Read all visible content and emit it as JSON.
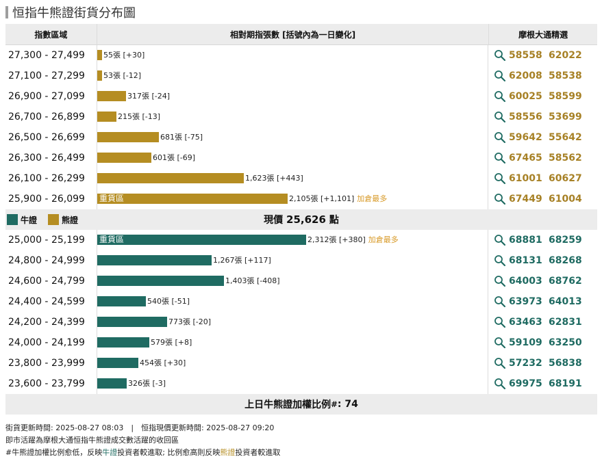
{
  "title": "恒指牛熊證街貨分布圖",
  "headers": {
    "range": "指數區域",
    "bars": "相對期指張數 [括號內為一日變化]",
    "picks": "摩根大通精選"
  },
  "colors": {
    "bear": "#b58d22",
    "bull": "#1f6b62",
    "most": "#d89a28"
  },
  "bear_rows": [
    {
      "range": "27,300 - 27,499",
      "count": 55,
      "label": "55張 [+30]",
      "inner": "",
      "most": "",
      "codes": [
        "58558",
        "62022"
      ]
    },
    {
      "range": "27,100 - 27,299",
      "count": 53,
      "label": "53張 [-12]",
      "inner": "",
      "most": "",
      "codes": [
        "62008",
        "58538"
      ]
    },
    {
      "range": "26,900 - 27,099",
      "count": 317,
      "label": "317張 [-24]",
      "inner": "",
      "most": "",
      "codes": [
        "60025",
        "58599"
      ]
    },
    {
      "range": "26,700 - 26,899",
      "count": 215,
      "label": "215張 [-13]",
      "inner": "",
      "most": "",
      "codes": [
        "58556",
        "53699"
      ]
    },
    {
      "range": "26,500 - 26,699",
      "count": 681,
      "label": "681張 [-75]",
      "inner": "",
      "most": "",
      "codes": [
        "59642",
        "55642"
      ]
    },
    {
      "range": "26,300 - 26,499",
      "count": 601,
      "label": "601張 [-69]",
      "inner": "",
      "most": "",
      "codes": [
        "67465",
        "58562"
      ]
    },
    {
      "range": "26,100 - 26,299",
      "count": 1623,
      "label": "1,623張 [+443]",
      "inner": "",
      "most": "",
      "codes": [
        "61001",
        "60627"
      ]
    },
    {
      "range": "25,900 - 26,099",
      "count": 2105,
      "label": "2,105張 [+1,101]",
      "inner": "重貨區",
      "most": "加倉最多",
      "codes": [
        "67449",
        "61004"
      ]
    }
  ],
  "legend": {
    "bull": "牛證",
    "bear": "熊證"
  },
  "current": {
    "prefix": "現價",
    "value": "25,626",
    "suffix": "點"
  },
  "bull_rows": [
    {
      "range": "25,000 - 25,199",
      "count": 2312,
      "label": "2,312張 [+380]",
      "inner": "重貨區",
      "most": "加倉最多",
      "codes": [
        "68881",
        "68259"
      ]
    },
    {
      "range": "24,800 - 24,999",
      "count": 1267,
      "label": "1,267張 [+117]",
      "inner": "",
      "most": "",
      "codes": [
        "68131",
        "68268"
      ]
    },
    {
      "range": "24,600 - 24,799",
      "count": 1403,
      "label": "1,403張 [-408]",
      "inner": "",
      "most": "",
      "codes": [
        "64003",
        "68762"
      ]
    },
    {
      "range": "24,400 - 24,599",
      "count": 540,
      "label": "540張 [-51]",
      "inner": "",
      "most": "",
      "codes": [
        "63973",
        "64013"
      ]
    },
    {
      "range": "24,200 - 24,399",
      "count": 773,
      "label": "773張 [-20]",
      "inner": "",
      "most": "",
      "codes": [
        "63463",
        "62831"
      ]
    },
    {
      "range": "24,000 - 24,199",
      "count": 579,
      "label": "579張 [+8]",
      "inner": "",
      "most": "",
      "codes": [
        "59109",
        "63250"
      ]
    },
    {
      "range": "23,800 - 23,999",
      "count": 454,
      "label": "454張 [+30]",
      "inner": "",
      "most": "",
      "codes": [
        "57232",
        "56838"
      ]
    },
    {
      "range": "23,600 - 23,799",
      "count": 326,
      "label": "326張 [-3]",
      "inner": "",
      "most": "",
      "codes": [
        "69975",
        "68191"
      ]
    }
  ],
  "footer": {
    "label": "上日牛熊證加權比例",
    "sup": "#",
    "value": ": 74"
  },
  "notes": {
    "line1": "街貨更新時間: 2025-08-27 08:03　|　恒指現價更新時間: 2025-08-27 09:20",
    "line2": "即市活躍為摩根大通恒指牛熊證成交數活躍的收回區",
    "line3a": "#牛熊證加權比例愈低，反映",
    "line3b": "牛證",
    "line3c": "投資者較進取; 比例愈高則反映",
    "line3d": "熊證",
    "line3e": "投資者較進取"
  }
}
